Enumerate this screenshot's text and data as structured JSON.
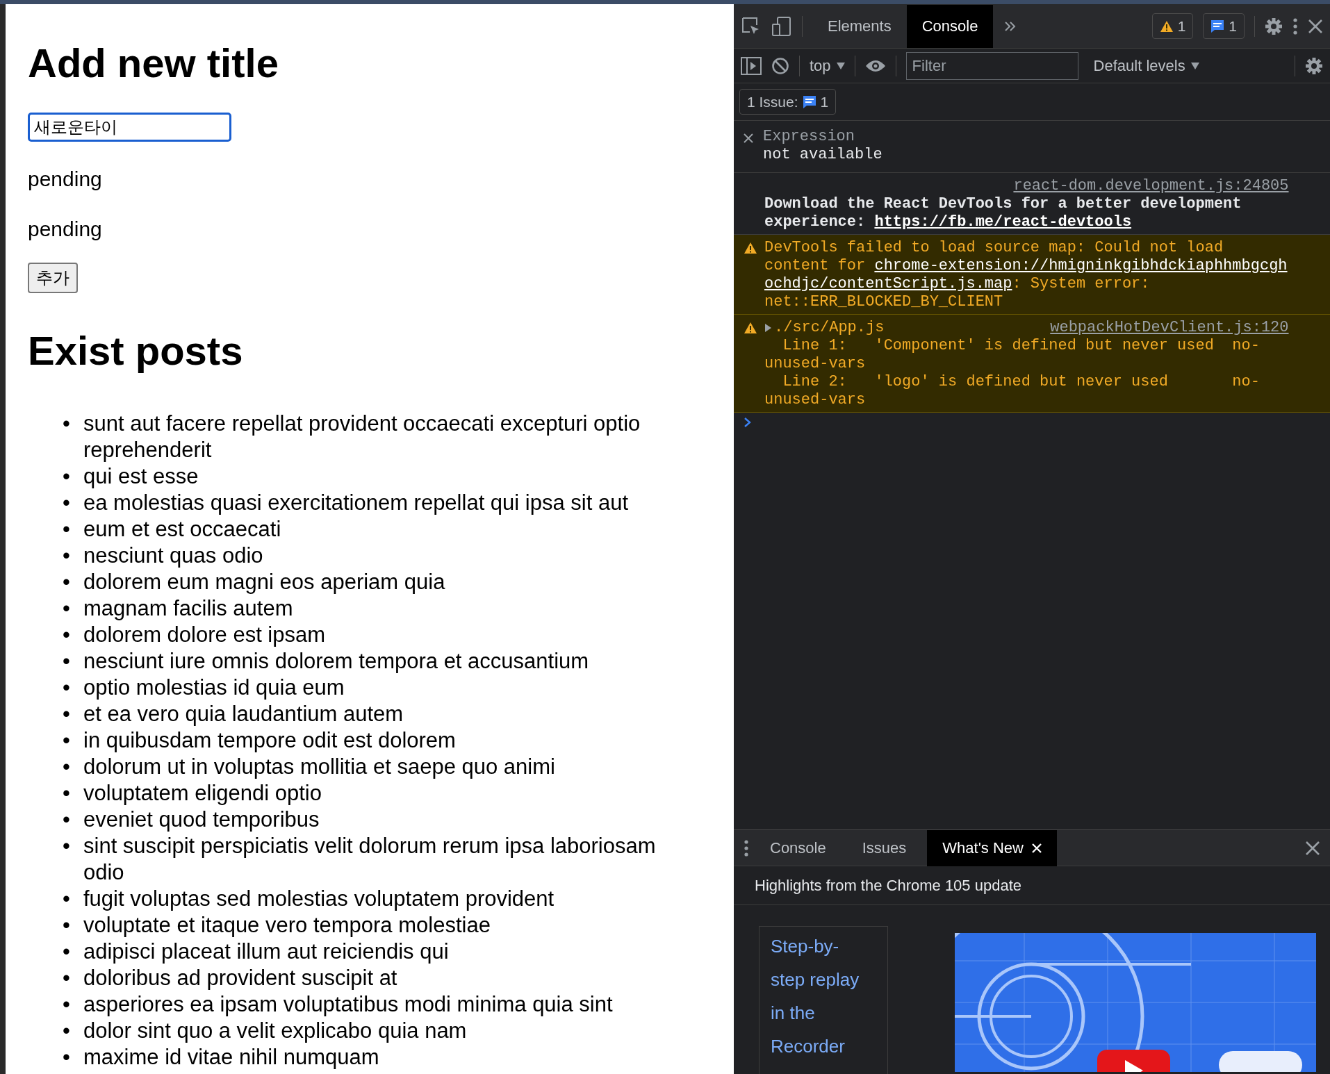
{
  "page": {
    "heading": "Add new title",
    "title_input": {
      "value": "새로운타이"
    },
    "status_lines": [
      "pending",
      "pending"
    ],
    "add_button": "추가",
    "posts_heading": "Exist posts",
    "posts": [
      {
        "bullet": "•",
        "title": "sunt aut facere repellat provident occaecati excepturi optio reprehenderit"
      },
      {
        "bullet": "•",
        "title": "qui est esse"
      },
      {
        "bullet": "•",
        "title": "ea molestias quasi exercitationem repellat qui ipsa sit aut"
      },
      {
        "bullet": "•",
        "title": "eum et est occaecati"
      },
      {
        "bullet": "•",
        "title": "nesciunt quas odio"
      },
      {
        "bullet": "•",
        "title": "dolorem eum magni eos aperiam quia"
      },
      {
        "bullet": "•",
        "title": "magnam facilis autem"
      },
      {
        "bullet": "•",
        "title": "dolorem dolore est ipsam"
      },
      {
        "bullet": "•",
        "title": "nesciunt iure omnis dolorem tempora et accusantium"
      },
      {
        "bullet": "•",
        "title": "optio molestias id quia eum"
      },
      {
        "bullet": "•",
        "title": "et ea vero quia laudantium autem"
      },
      {
        "bullet": "•",
        "title": "in quibusdam tempore odit est dolorem"
      },
      {
        "bullet": "•",
        "title": "dolorum ut in voluptas mollitia et saepe quo animi"
      },
      {
        "bullet": "•",
        "title": "voluptatem eligendi optio"
      },
      {
        "bullet": "•",
        "title": "eveniet quod temporibus"
      },
      {
        "bullet": "•",
        "title": "sint suscipit perspiciatis velit dolorum rerum ipsa laboriosam odio"
      },
      {
        "bullet": "•",
        "title": "fugit voluptas sed molestias voluptatem provident"
      },
      {
        "bullet": "•",
        "title": "voluptate et itaque vero tempora molestiae"
      },
      {
        "bullet": "•",
        "title": "adipisci placeat illum aut reiciendis qui"
      },
      {
        "bullet": "•",
        "title": "doloribus ad provident suscipit at"
      },
      {
        "bullet": "•",
        "title": "asperiores ea ipsam voluptatibus modi minima quia sint"
      },
      {
        "bullet": "•",
        "title": "dolor sint quo a velit explicabo quia nam"
      },
      {
        "bullet": "•",
        "title": "maxime id vitae nihil numquam"
      }
    ]
  },
  "devtools": {
    "tabs": [
      {
        "label": "Elements",
        "selected": false
      },
      {
        "label": "Console",
        "selected": true
      }
    ],
    "warning_count": "1",
    "message_count": "1",
    "console_toolbar": {
      "context": "top",
      "filter": {
        "placeholder": "Filter"
      },
      "levels": "Default levels"
    },
    "issues_button": {
      "label": "1 Issue:",
      "count": "1"
    },
    "expression": {
      "label": "Expression",
      "value": "not available"
    },
    "messages": [
      {
        "kind": "info",
        "source": "react-dom.development.js:24805",
        "segments": [
          {
            "text": "Download the React DevTools for a better development experience: ",
            "kind": "text"
          },
          {
            "text": "https://fb.me/react-devtools",
            "kind": "link"
          }
        ]
      },
      {
        "kind": "warning",
        "segments": [
          {
            "text": "DevTools failed to load source map: Could not load content for ",
            "kind": "text"
          },
          {
            "text": "chrome-extension://hmigninkgibhdckiaphhmbgcgh",
            "kind": "link"
          },
          {
            "text": "ochdjc/contentScript.js.map",
            "kind": "link"
          },
          {
            "text": ": System error: net::ERR_BLOCKED_BY_CLIENT",
            "kind": "text"
          }
        ]
      },
      {
        "kind": "warning",
        "title": "./src/App.js",
        "expanded": false,
        "source": "webpackHotDevClient.js:120",
        "lines": [
          "  Line 1:   'Component' is defined but never used  no-unused-vars",
          "  Line 2:   'logo' is defined but never used       no-unused-vars"
        ]
      }
    ],
    "drawer": {
      "tabs": [
        {
          "label": "Console",
          "selected": false
        },
        {
          "label": "Issues",
          "selected": false
        },
        {
          "label": "What's New",
          "selected": true
        }
      ],
      "headline": "Highlights from the Chrome 105 update",
      "feature_link": "Step-by-step replay in the Recorder"
    }
  }
}
